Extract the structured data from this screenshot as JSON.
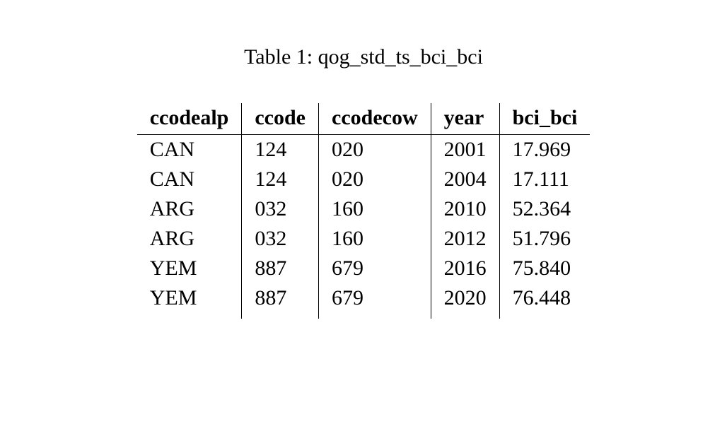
{
  "caption": "Table 1: qog_std_ts_bci_bci",
  "columns": [
    "ccodealp",
    "ccode",
    "ccodecow",
    "year",
    "bci_bci"
  ],
  "rows": [
    {
      "ccodealp": "CAN",
      "ccode": "124",
      "ccodecow": "020",
      "year": "2001",
      "bci_bci": "17.969"
    },
    {
      "ccodealp": "CAN",
      "ccode": "124",
      "ccodecow": "020",
      "year": "2004",
      "bci_bci": "17.111"
    },
    {
      "ccodealp": "ARG",
      "ccode": "032",
      "ccodecow": "160",
      "year": "2010",
      "bci_bci": "52.364"
    },
    {
      "ccodealp": "ARG",
      "ccode": "032",
      "ccodecow": "160",
      "year": "2012",
      "bci_bci": "51.796"
    },
    {
      "ccodealp": "YEM",
      "ccode": "887",
      "ccodecow": "679",
      "year": "2016",
      "bci_bci": "75.840"
    },
    {
      "ccodealp": "YEM",
      "ccode": "887",
      "ccodecow": "679",
      "year": "2020",
      "bci_bci": "76.448"
    }
  ]
}
